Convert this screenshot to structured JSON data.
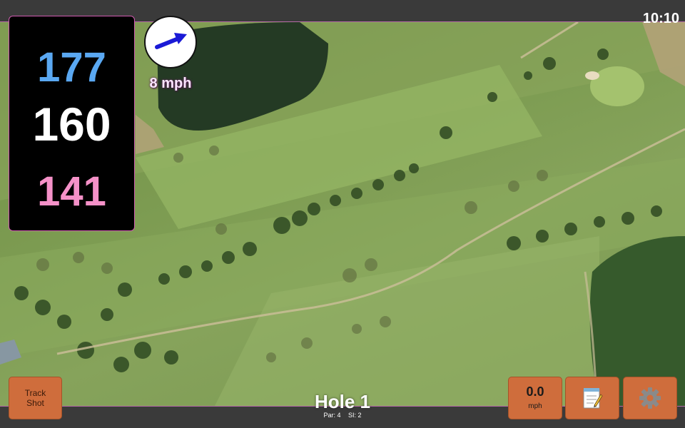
{
  "status_bar": {
    "time": "10:10"
  },
  "distances": {
    "back": "177",
    "middle": "160",
    "front": "141"
  },
  "wind": {
    "speed_label": "8 mph",
    "direction": "east-north-east"
  },
  "hole": {
    "title": "Hole 1",
    "par": "Par: 4",
    "stroke_index": "SI: 2"
  },
  "buttons": {
    "track_shot_line1": "Track",
    "track_shot_line2": "Shot",
    "speed_value": "0.0",
    "speed_unit": "mph",
    "notes_icon": "notepad-icon",
    "settings_icon": "gear-icon"
  },
  "colors": {
    "back_distance": "#5aa8f2",
    "middle_distance": "#ffffff",
    "front_distance": "#f591c8",
    "button_bg": "#cf6d3c",
    "wind_arrow": "#1a1ad6"
  }
}
